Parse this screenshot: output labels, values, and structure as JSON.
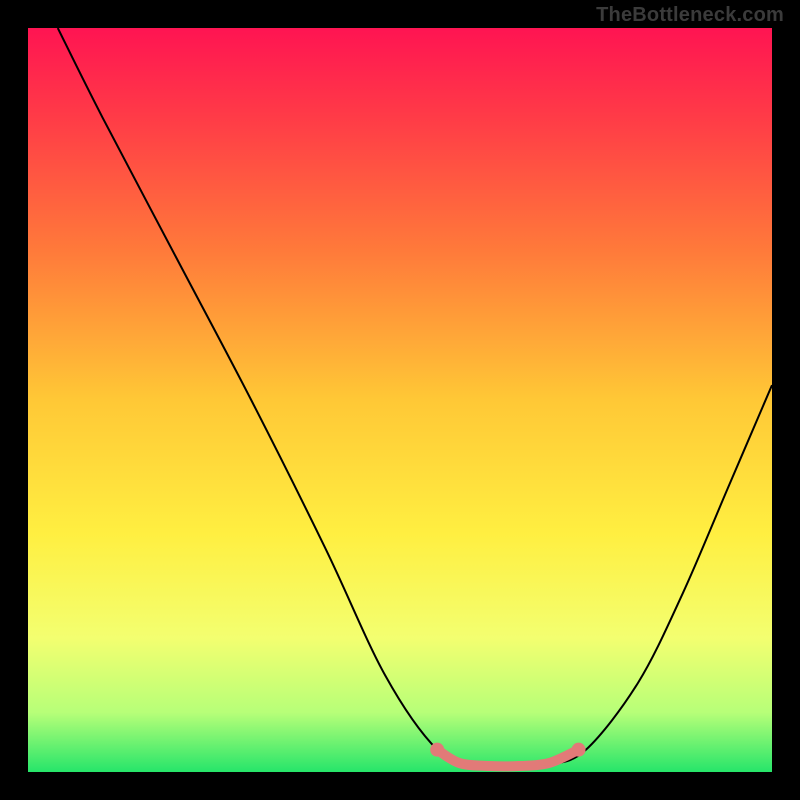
{
  "watermark": "TheBottleneck.com",
  "chart_data": {
    "type": "line",
    "title": "",
    "xlabel": "",
    "ylabel": "",
    "xlim": [
      0,
      100
    ],
    "ylim": [
      0,
      100
    ],
    "grid": false,
    "series": [
      {
        "name": "curve",
        "x": [
          4,
          10,
          20,
          30,
          40,
          48,
          55,
          60,
          65,
          70,
          75,
          82,
          88,
          94,
          100
        ],
        "values": [
          100,
          88,
          69,
          50,
          30,
          13,
          3,
          1,
          1,
          1,
          3,
          12,
          24,
          38,
          52
        ]
      }
    ],
    "highlight_segment": {
      "x": [
        55,
        58,
        62,
        66,
        70,
        74
      ],
      "values": [
        3,
        1.2,
        0.8,
        0.8,
        1.2,
        3
      ],
      "color": "#e27a78"
    },
    "background_gradient": {
      "stops": [
        {
          "offset": 0.0,
          "color": "#ff1452"
        },
        {
          "offset": 0.12,
          "color": "#ff3b47"
        },
        {
          "offset": 0.3,
          "color": "#ff7a3a"
        },
        {
          "offset": 0.5,
          "color": "#ffc836"
        },
        {
          "offset": 0.68,
          "color": "#ffef41"
        },
        {
          "offset": 0.82,
          "color": "#f3ff70"
        },
        {
          "offset": 0.92,
          "color": "#b7ff78"
        },
        {
          "offset": 1.0,
          "color": "#26e56a"
        }
      ]
    }
  }
}
